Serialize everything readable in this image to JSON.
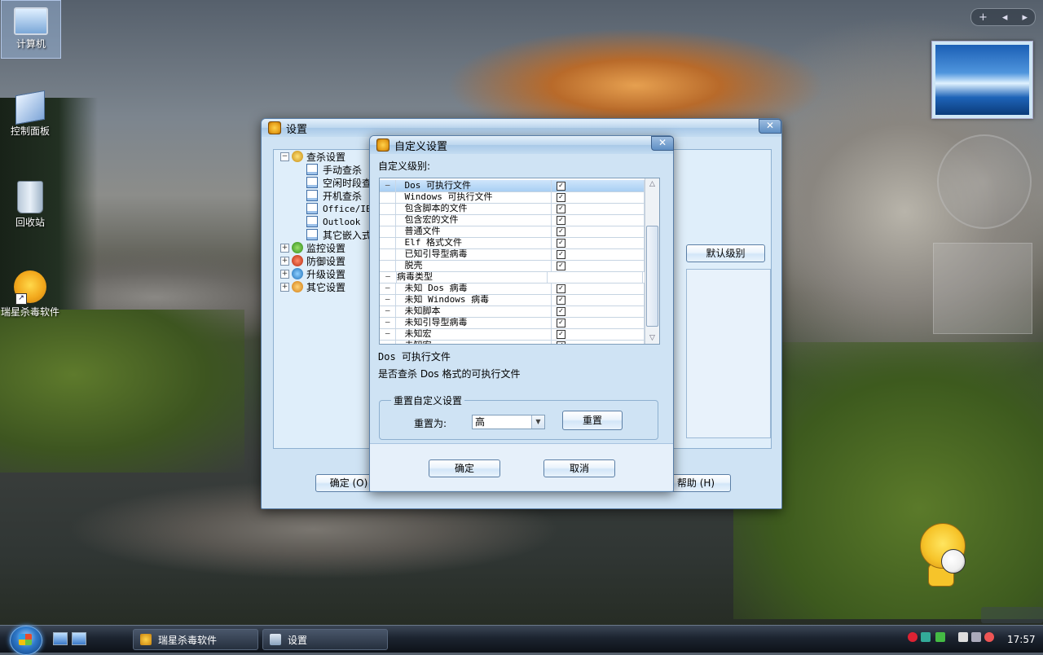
{
  "desktop": {
    "icons": [
      {
        "label": "计算机",
        "icon": "computer-icon"
      },
      {
        "label": "控制面板",
        "icon": "control-panel-icon"
      },
      {
        "label": "回收站",
        "icon": "recycle-bin-icon"
      },
      {
        "label": "瑞星杀毒软件",
        "icon": "rising-lion-icon"
      }
    ]
  },
  "settings_window": {
    "title": "设置",
    "tree": [
      {
        "label": "查杀设置",
        "expanded": true,
        "children": [
          "手动查杀",
          "空闲时段查",
          "开机查杀",
          "Office/IE",
          "Outlook",
          "其它嵌入式"
        ]
      },
      {
        "label": "监控设置"
      },
      {
        "label": "防御设置"
      },
      {
        "label": "升级设置"
      },
      {
        "label": "其它设置"
      }
    ],
    "default_level_button": "默认级别",
    "ok_button": "确定 (O)",
    "help_button": "帮助 (H)"
  },
  "custom_dialog": {
    "title": "自定义设置",
    "level_caption": "自定义级别:",
    "list_rows": [
      {
        "expander": "−",
        "label": "Dos 可执行文件",
        "checked": true,
        "selected": true
      },
      {
        "expander": "",
        "label": "Windows 可执行文件",
        "checked": true
      },
      {
        "expander": "",
        "label": "包含脚本的文件",
        "checked": true
      },
      {
        "expander": "",
        "label": "包含宏的文件",
        "checked": true
      },
      {
        "expander": "",
        "label": "普通文件",
        "checked": true
      },
      {
        "expander": "",
        "label": "Elf 格式文件",
        "checked": true
      },
      {
        "expander": "",
        "label": "已知引导型病毒",
        "checked": true
      },
      {
        "expander": "",
        "label": "脱壳",
        "checked": true
      },
      {
        "expander": "−",
        "label": "病毒类型",
        "checked": null,
        "header": true
      },
      {
        "expander": "−",
        "label": "未知 Dos 病毒",
        "checked": true
      },
      {
        "expander": "−",
        "label": "未知 Windows 病毒",
        "checked": true
      },
      {
        "expander": "−",
        "label": "未知脚本",
        "checked": true
      },
      {
        "expander": "−",
        "label": "未知引导型病毒",
        "checked": true
      },
      {
        "expander": "−",
        "label": "未知宏",
        "checked": true
      },
      {
        "expander": "−",
        "label": "未知宏",
        "checked": true
      }
    ],
    "desc_title": "Dos 可执行文件",
    "desc_text": "是否查杀 Dos 格式的可执行文件",
    "reset_group_legend": "重置自定义设置",
    "reset_to_label": "重置为:",
    "reset_level_value": "高",
    "reset_button": "重置",
    "ok_button": "确定",
    "cancel_button": "取消"
  },
  "taskbar": {
    "tasks": [
      {
        "label": "瑞星杀毒软件",
        "icon": "rising-lion-icon"
      },
      {
        "label": "设置",
        "icon": "settings-window-icon"
      }
    ],
    "clock": "17:57"
  },
  "gadgets": {
    "controls": [
      "+",
      "◂",
      "▸"
    ]
  }
}
